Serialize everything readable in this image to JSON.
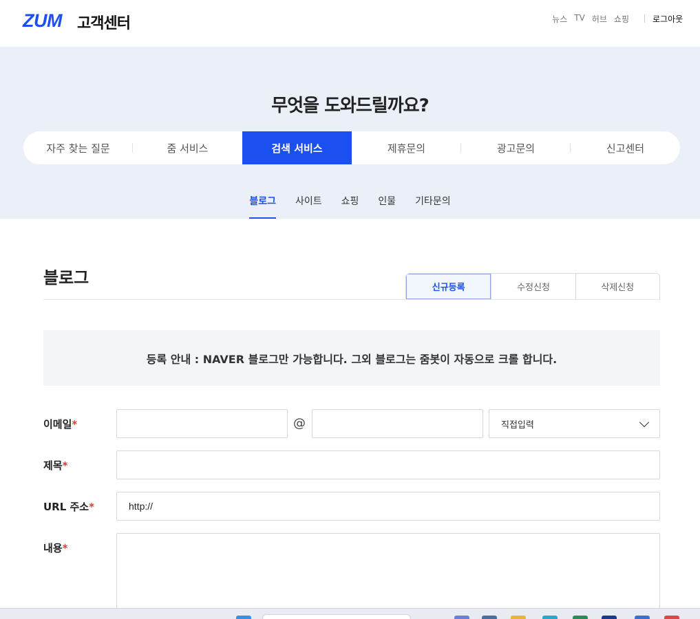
{
  "header": {
    "logo": "ZUM",
    "title": "고객센터",
    "nav": [
      "뉴스",
      "TV",
      "허브",
      "쇼핑"
    ],
    "logout": "로그아웃"
  },
  "hero": {
    "title": "무엇을 도와드릴까요?",
    "main_tabs": [
      "자주 찾는 질문",
      "줌 서비스",
      "검색 서비스",
      "제휴문의",
      "광고문의",
      "신고센터"
    ],
    "main_tab_active": "검색 서비스",
    "sub_tabs": [
      "블로그",
      "사이트",
      "쇼핑",
      "인물",
      "기타문의"
    ],
    "sub_tab_active": "블로그"
  },
  "section": {
    "title": "블로그",
    "reg_tabs": [
      "신규등록",
      "수정신청",
      "삭제신청"
    ],
    "reg_tab_active": "신규등록"
  },
  "notice": "등록 안내 : NAVER 블로그만 가능합니다. 그외 블로그는 줌봇이 자동으로 크롤 합니다.",
  "form": {
    "email_label": "이메일",
    "at": "@",
    "email_domain_select": "직접입력",
    "subject_label": "제목",
    "url_label": "URL 주소",
    "url_value": "http://",
    "content_label": "내용",
    "required_mark": "*"
  },
  "colors": {
    "brand": "#1b4ff0",
    "hero_bg": "#ebf0f8",
    "required": "#e53935"
  }
}
